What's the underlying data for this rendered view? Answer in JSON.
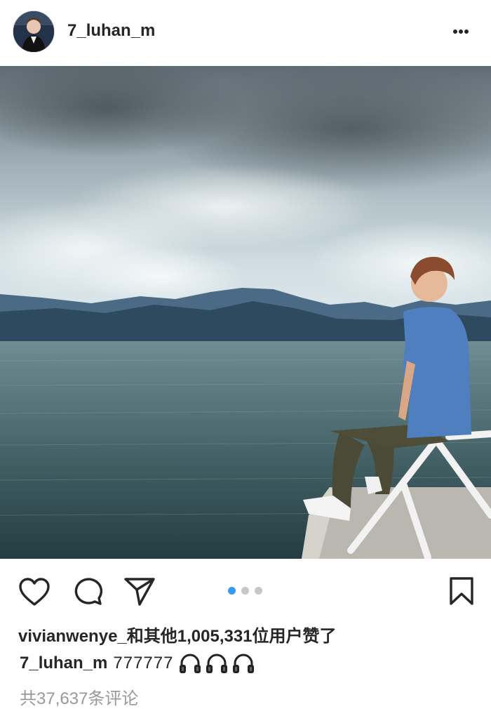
{
  "post": {
    "username": "7_luhan_m",
    "more_icon": "more-horizontal-icon",
    "likes_text": "vivianwenye_和其他1,005,331位用户赞了",
    "caption_user": "7_luhan_m",
    "caption_text": "777777",
    "caption_emoji": [
      "headphone-icon",
      "headphone-icon",
      "headphone-icon"
    ],
    "comments_text": "共37,637条评论"
  },
  "carousel": {
    "count": 3,
    "active_index": 0
  },
  "actions": [
    "heart-icon",
    "comment-icon",
    "share-icon",
    "bookmark-icon"
  ],
  "colors": {
    "text": "#262626",
    "muted": "#999999",
    "active_dot": "#3897f0",
    "inactive_dot": "#c7c7c7"
  }
}
